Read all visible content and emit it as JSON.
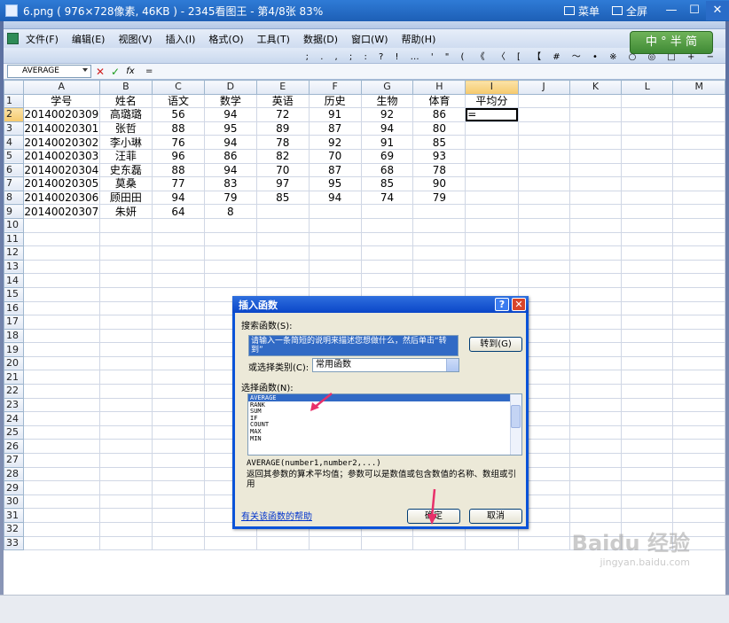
{
  "viewer": {
    "title": "6.png ( 976×728像素, 46KB ) - 2345看图王 - 第4/8张 83%",
    "menu_label": "菜单",
    "fullscreen_label": "全屏",
    "minimize": "—",
    "maximize": "☐",
    "close": "✕"
  },
  "excel": {
    "menus": [
      "文件(F)",
      "编辑(E)",
      "视图(V)",
      "插入(I)",
      "格式(O)",
      "工具(T)",
      "数据(D)",
      "窗口(W)",
      "帮助(H)"
    ],
    "symbols": "; . , ; : ? ! … ' \" ( 《 〈 [ 【 # ～ • ※ ○ ◎ □ + −",
    "logo_text": "中 ° 半 简",
    "name_box": "AVERAGE",
    "formula_cancel": "✕",
    "formula_enter": "✓",
    "formula_fx": "fx",
    "formula_content": "=",
    "columns": [
      "A",
      "B",
      "C",
      "D",
      "E",
      "F",
      "G",
      "H",
      "I",
      "J",
      "K",
      "L",
      "M"
    ],
    "active_column": "I",
    "active_row": "2",
    "header_row": [
      "学号",
      "姓名",
      "语文",
      "数学",
      "英语",
      "历史",
      "生物",
      "体育",
      "平均分"
    ],
    "rows": [
      [
        "20140020309",
        "高璐璐",
        "56",
        "94",
        "72",
        "91",
        "92",
        "86",
        "="
      ],
      [
        "20140020301",
        "张哲",
        "88",
        "95",
        "89",
        "87",
        "94",
        "80",
        ""
      ],
      [
        "20140020302",
        "李小琳",
        "76",
        "94",
        "78",
        "92",
        "91",
        "85",
        ""
      ],
      [
        "20140020303",
        "汪菲",
        "96",
        "86",
        "82",
        "70",
        "69",
        "93",
        ""
      ],
      [
        "20140020304",
        "史东磊",
        "88",
        "94",
        "70",
        "87",
        "68",
        "78",
        ""
      ],
      [
        "20140020305",
        "莫桑",
        "77",
        "83",
        "97",
        "95",
        "85",
        "90",
        ""
      ],
      [
        "20140020306",
        "顾田田",
        "94",
        "79",
        "85",
        "94",
        "74",
        "79",
        ""
      ],
      [
        "20140020307",
        "朱妍",
        "64",
        "8",
        "",
        "",
        "",
        "",
        ""
      ]
    ],
    "row_count": 33
  },
  "dialog": {
    "title": "插入函数",
    "help_btn": "?",
    "close_btn": "✕",
    "search_label": "搜索函数(S):",
    "search_text": "请输入一条简短的说明来描述您想做什么，然后单击“转到”",
    "go_button": "转到(G)",
    "category_label": "或选择类别(C):",
    "category_value": "常用函数",
    "select_label": "选择函数(N):",
    "functions": [
      "AVERAGE",
      "RANK",
      "SUM",
      "IF",
      "COUNT",
      "MAX",
      "MIN"
    ],
    "selected_function": "AVERAGE",
    "signature": "AVERAGE(number1,number2,...)",
    "description": "返回其参数的算术平均值；参数可以是数值或包含数值的名称、数组或引用",
    "help_link": "有关该函数的帮助",
    "ok_button": "确定",
    "cancel_button": "取消"
  },
  "watermark": {
    "main": "Baidu 经验",
    "sub": "jingyan.baidu.com"
  },
  "colors": {
    "title_bar": "#1d5fb6",
    "dialog_title": "#0a46c8",
    "selection": "#316ac5",
    "annotation_arrow": "#e8306a"
  }
}
